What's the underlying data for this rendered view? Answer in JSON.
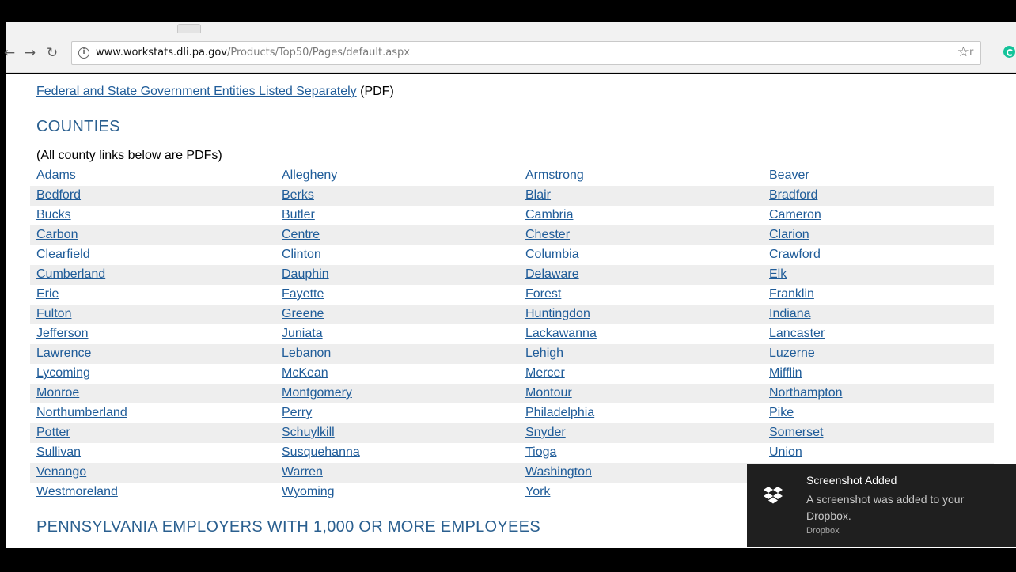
{
  "browser": {
    "url_domain": "www.workstats.dli.pa.gov",
    "url_path": "/Products/Top50/Pages/default.aspx",
    "extension_label": "r"
  },
  "page": {
    "federal_link": "Federal and State Government Entities Listed Separately",
    "federal_suffix": " (PDF)",
    "counties_heading": "COUNTIES",
    "counties_note": "(All county links below are PDFs)",
    "counties": [
      [
        "Adams",
        "Allegheny",
        "Armstrong",
        "Beaver"
      ],
      [
        "Bedford",
        "Berks",
        "Blair",
        "Bradford"
      ],
      [
        "Bucks",
        "Butler",
        "Cambria",
        "Cameron"
      ],
      [
        "Carbon",
        "Centre",
        "Chester",
        "Clarion"
      ],
      [
        "Clearfield",
        "Clinton",
        "Columbia",
        "Crawford"
      ],
      [
        "Cumberland",
        "Dauphin",
        "Delaware",
        "Elk"
      ],
      [
        "Erie",
        "Fayette",
        "Forest",
        "Franklin"
      ],
      [
        "Fulton",
        "Greene",
        "Huntingdon",
        "Indiana"
      ],
      [
        "Jefferson",
        "Juniata",
        "Lackawanna",
        "Lancaster"
      ],
      [
        "Lawrence",
        "Lebanon",
        "Lehigh",
        "Luzerne"
      ],
      [
        "Lycoming",
        "McKean",
        "Mercer",
        "Mifflin"
      ],
      [
        "Monroe",
        "Montgomery",
        "Montour",
        "Northampton"
      ],
      [
        "Northumberland",
        "Perry",
        "Philadelphia",
        "Pike"
      ],
      [
        "Potter",
        "Schuylkill",
        "Snyder",
        "Somerset"
      ],
      [
        "Sullivan",
        "Susquehanna",
        "Tioga",
        "Union"
      ],
      [
        "Venango",
        "Warren",
        "Washington",
        ""
      ],
      [
        "Westmoreland",
        "Wyoming",
        "York",
        ""
      ]
    ],
    "employers_heading": "PENNSYLVANIA EMPLOYERS WITH 1,000 OR MORE EMPLOYEES"
  },
  "notification": {
    "title": "Screenshot Added",
    "body": "A screenshot was added to your Dropbox.",
    "source": "Dropbox",
    "icon": "dropbox-icon"
  },
  "colors": {
    "link": "#1f5c99",
    "heading": "#2a5f8f",
    "row_alt": "#eeeeee",
    "toast_bg": "#1f1f1f"
  }
}
